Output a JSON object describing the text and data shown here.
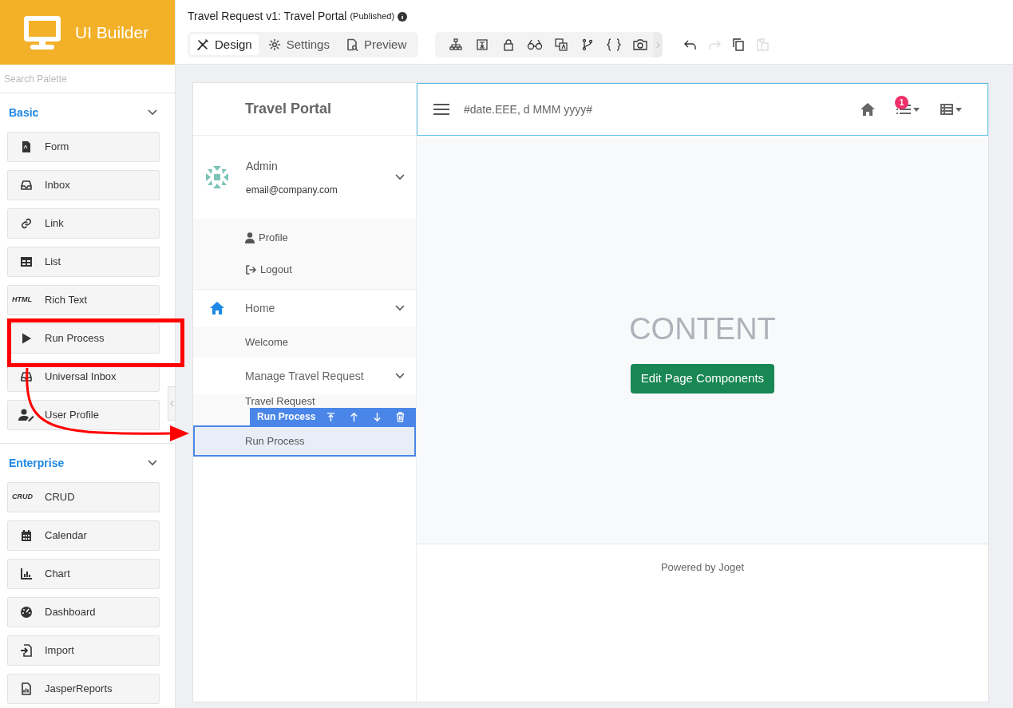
{
  "app": {
    "title": "UI Builder"
  },
  "header": {
    "title": "Travel Request v1: Travel Portal",
    "status": "(Published)"
  },
  "mode_tabs": [
    {
      "label": "Design",
      "kind": "design",
      "selected": true
    },
    {
      "label": "Settings",
      "kind": "gear",
      "selected": false
    },
    {
      "label": "Preview",
      "kind": "preview",
      "selected": false
    }
  ],
  "history": {
    "undo_enabled": true,
    "redo_enabled": false,
    "copy_enabled": true,
    "paste_enabled": false
  },
  "palette": {
    "placeholder": "Search Palette",
    "sections": [
      {
        "title": "Basic",
        "expanded": true,
        "items": [
          {
            "label": "Form",
            "kind": "form"
          },
          {
            "label": "Inbox",
            "kind": "inbox"
          },
          {
            "label": "Link",
            "kind": "link"
          },
          {
            "label": "List",
            "kind": "list"
          },
          {
            "label": "Rich Text",
            "kind": "text",
            "icon_text": "HTML"
          },
          {
            "label": "Run Process",
            "kind": "play"
          },
          {
            "label": "Universal Inbox",
            "kind": "inbox"
          },
          {
            "label": "User Profile",
            "kind": "user-edit"
          }
        ]
      },
      {
        "title": "Enterprise",
        "expanded": true,
        "items": [
          {
            "label": "CRUD",
            "kind": "text",
            "icon_text": "CRUD"
          },
          {
            "label": "Calendar",
            "kind": "calendar"
          },
          {
            "label": "Chart",
            "kind": "chart"
          },
          {
            "label": "Dashboard",
            "kind": "dashboard"
          },
          {
            "label": "Import",
            "kind": "import"
          },
          {
            "label": "JasperReports",
            "kind": "report"
          }
        ]
      }
    ]
  },
  "portal": {
    "title": "Travel Portal",
    "date_text": "#date.EEE, d MMM yyyy#",
    "notification_count": "1",
    "user": {
      "name": "Admin",
      "email": "email@company.com",
      "expanded": true,
      "menu": [
        {
          "label": "Profile",
          "kind": "user"
        },
        {
          "label": "Logout",
          "kind": "logout"
        }
      ]
    },
    "menu": [
      {
        "label": "Home",
        "kind": "home",
        "expanded": true,
        "children": [
          {
            "label": "Welcome",
            "selected": false
          }
        ]
      },
      {
        "label": "Manage Travel Request",
        "kind": "plain",
        "expanded": true,
        "children": [
          {
            "label": "Travel Request",
            "selected": false
          },
          {
            "label": "Run Process",
            "selected": true
          }
        ]
      }
    ],
    "element_toolbar": {
      "label": "Run Process"
    },
    "content": {
      "placeholder_title": "CONTENT",
      "button": "Edit Page Components"
    },
    "footer": "Powered by Joget"
  }
}
